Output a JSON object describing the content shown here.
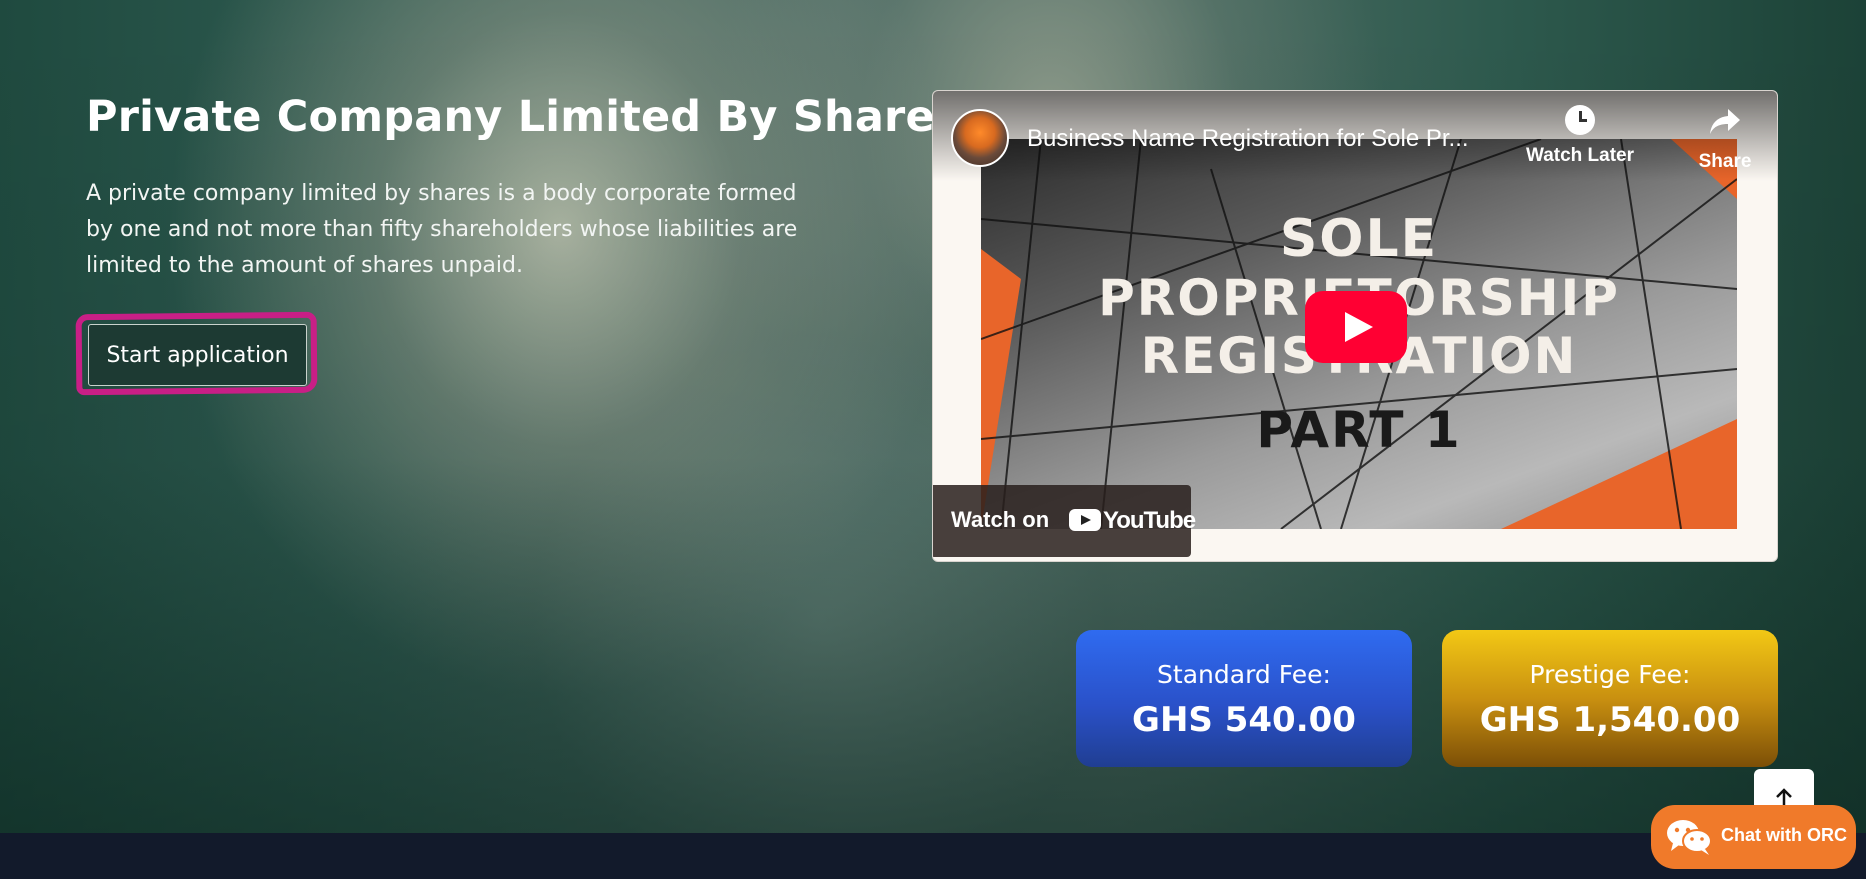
{
  "hero": {
    "title": "Private Company Limited By Shares",
    "description": "A private company limited by shares is a body corporate formed by one and not more than fifty shareholders whose liabilities are limited to the amount of shares unpaid.",
    "start_button_label": "Start application",
    "highlight_color": "#c81f86"
  },
  "video": {
    "title": "Business Name Registration for Sole Pr...",
    "watch_later_label": "Watch Later",
    "share_label": "Share",
    "thumbnail_lines": [
      "SOLE",
      "PROPRIETORSHIP",
      "REGISTRATION",
      "PART 1"
    ],
    "watch_on_label": "Watch on",
    "youtube_label": "YouTube",
    "play_color": "#ff0033"
  },
  "fees": {
    "standard": {
      "label": "Standard Fee:",
      "value": "GHS 540.00",
      "color": "#2a51c9"
    },
    "prestige": {
      "label": "Prestige Fee:",
      "value": "GHS 1,540.00",
      "color": "#c99010"
    }
  },
  "chat": {
    "label": "Chat with ORC",
    "icon": "wechat-icon",
    "color": "#f07a2a"
  },
  "scroll_top": {
    "icon": "arrow-up-icon"
  }
}
